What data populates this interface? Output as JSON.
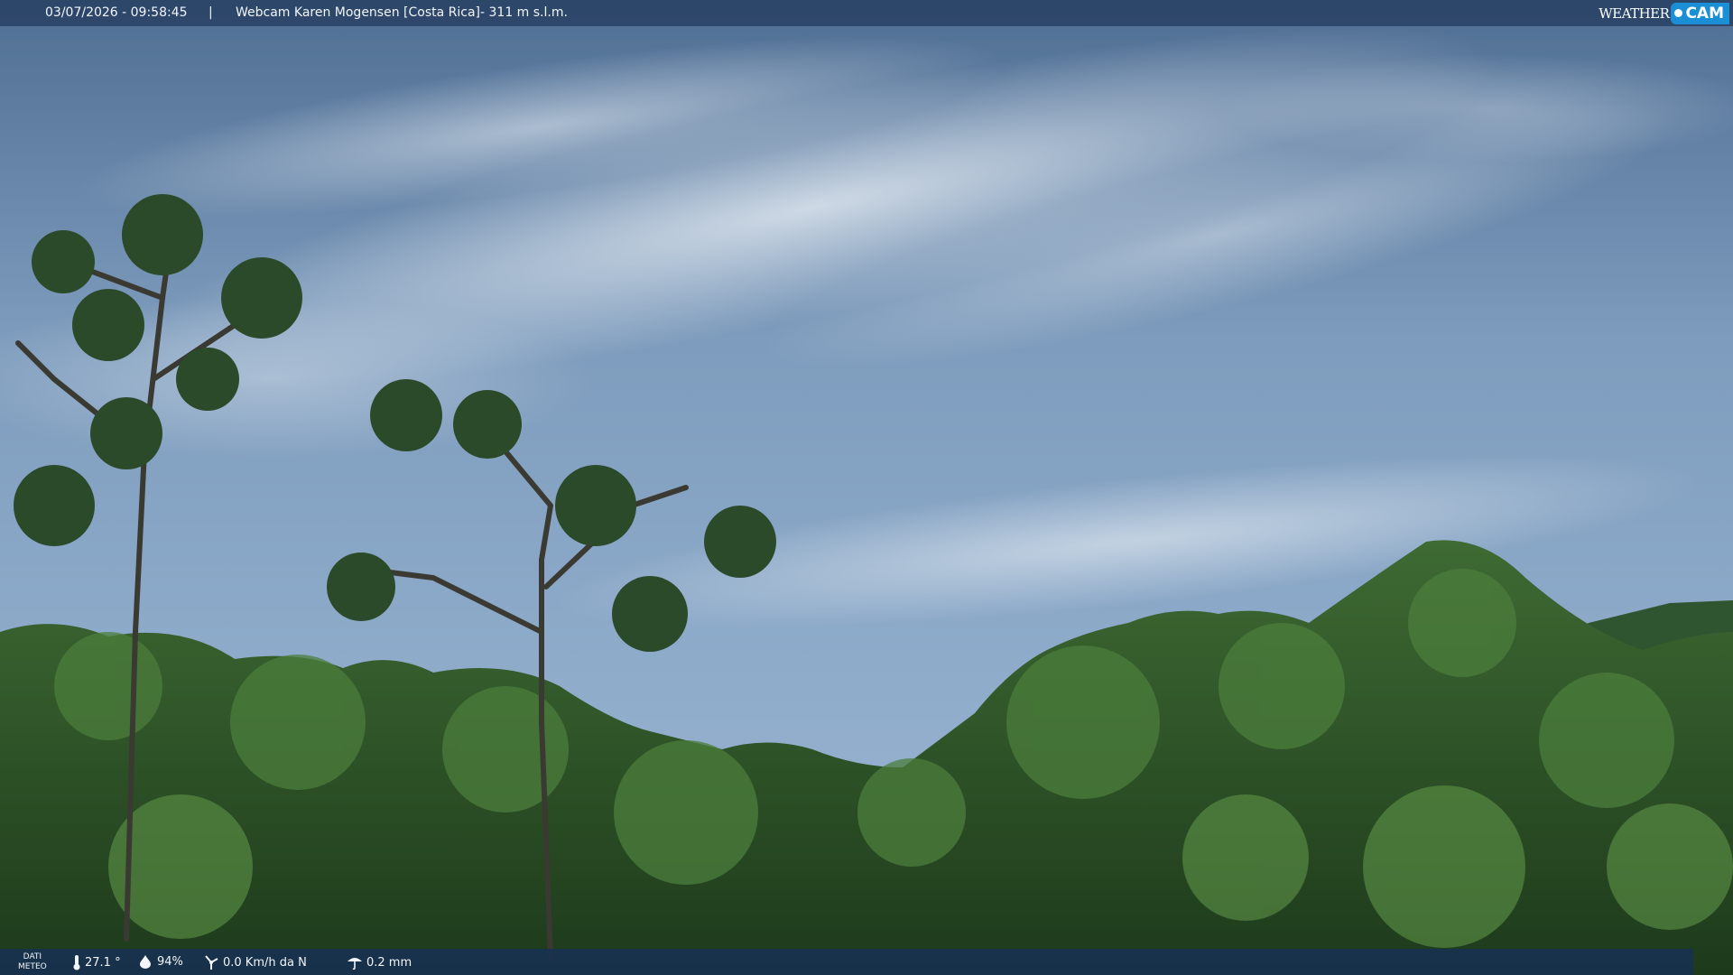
{
  "overlay": {
    "timestamp": "03/07/2026 - 09:58:45",
    "separator": "|",
    "location": "Webcam Karen Mogensen [Costa Rica]",
    "altitude": "- 311 m s.l.m.",
    "brand_weather": "WEATHER",
    "brand_cam": "CAM"
  },
  "weather": {
    "panel_label_1": "DATI",
    "panel_label_2": "METEO",
    "temperature": "27.1 °",
    "humidity": "94%",
    "wind": "0.0 Km/h da N",
    "rain": "0.2 mm",
    "icons": [
      "thermometer-icon",
      "humidity-icon",
      "wind-icon",
      "rain-icon"
    ]
  },
  "colors": {
    "bar_top": "#263e60",
    "bar_bottom": "#163052",
    "brand_blue": "#1b8fd6"
  }
}
